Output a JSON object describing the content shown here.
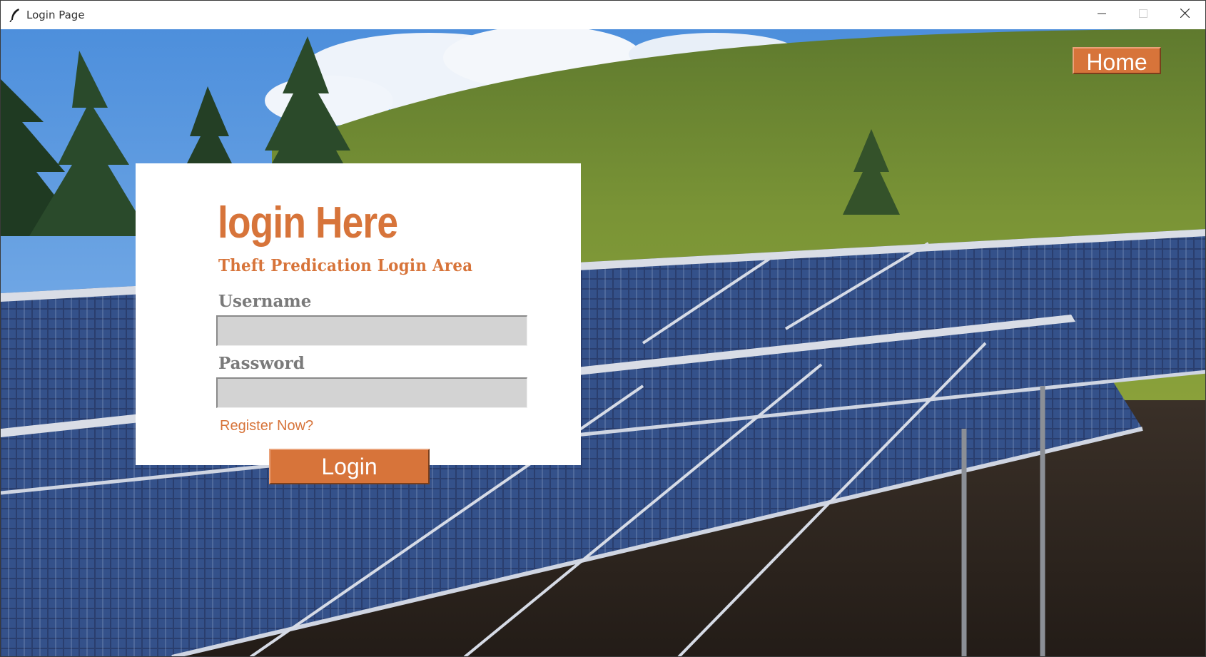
{
  "window": {
    "title": "Login Page",
    "controls": [
      "minimize",
      "maximize",
      "close"
    ]
  },
  "header": {
    "home_label": "Home"
  },
  "login": {
    "heading": "login Here",
    "subheading": "Theft Predication Login Area",
    "username_label": "Username",
    "username_value": "",
    "password_label": "Password",
    "password_value": "",
    "register_link": "Register Now?",
    "login_button": "Login"
  },
  "colors": {
    "accent": "#d7743a",
    "input_bg": "#d3d3d3",
    "label": "#7a7a7a",
    "card_bg": "#ffffff"
  },
  "icons": {
    "app": "feather-icon",
    "minimize": "minimize-icon",
    "maximize": "maximize-icon",
    "close": "close-icon"
  }
}
